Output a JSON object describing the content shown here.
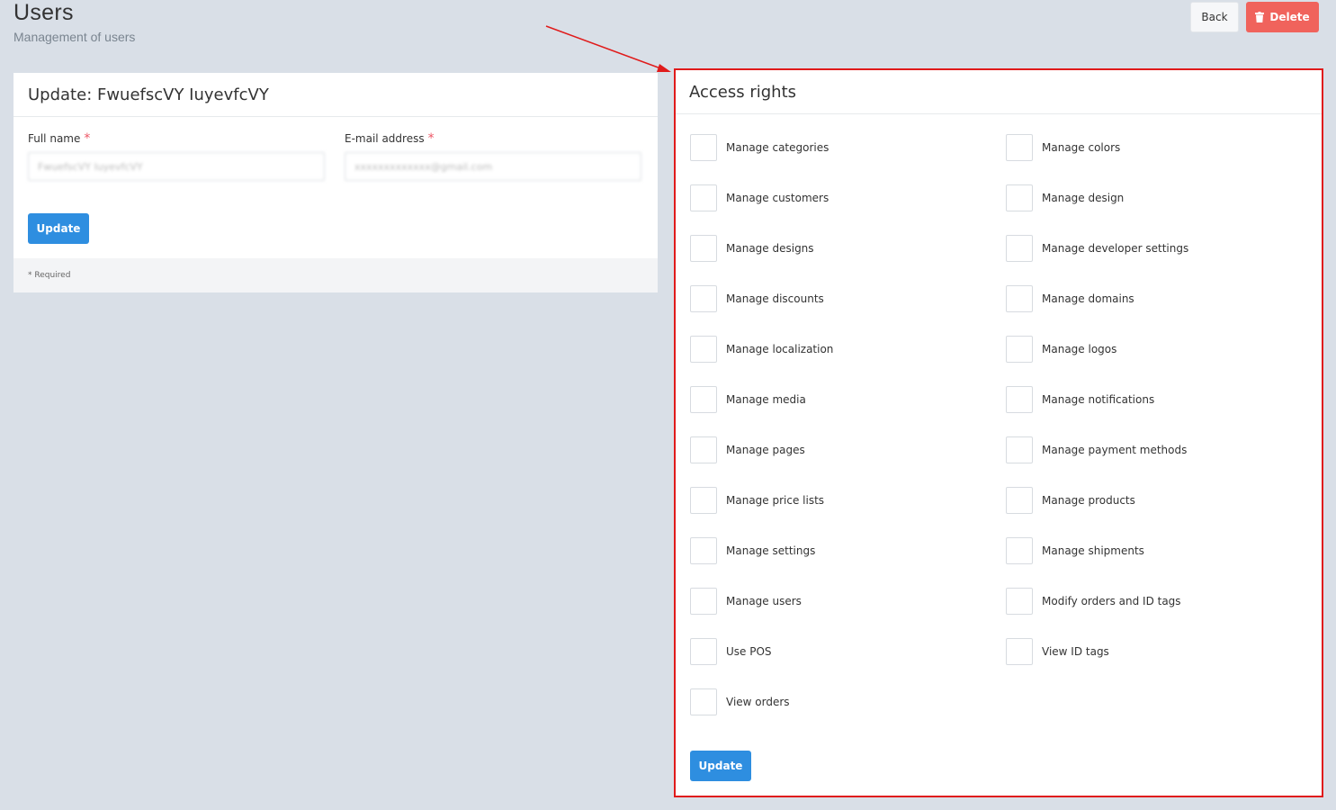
{
  "page": {
    "title": "Users",
    "subtitle": "Management of users"
  },
  "toolbar": {
    "back_label": "Back",
    "delete_label": "Delete",
    "delete_icon": "trash-icon"
  },
  "update_form": {
    "title": "Update: FwuefscVY IuyevfcVY",
    "full_name_label": "Full name",
    "email_label": "E-mail address",
    "required_mark": "*",
    "full_name_value": "FwuefscVY IuyevfcVY",
    "email_value": "xxxxxxxxxxxxx@gmail.com",
    "update_label": "Update",
    "footer_note": "* Required"
  },
  "access_rights": {
    "title": "Access rights",
    "update_label": "Update",
    "items": [
      {
        "label": "Manage categories",
        "checked": false
      },
      {
        "label": "Manage colors",
        "checked": false
      },
      {
        "label": "Manage customers",
        "checked": false
      },
      {
        "label": "Manage design",
        "checked": false
      },
      {
        "label": "Manage designs",
        "checked": false
      },
      {
        "label": "Manage developer settings",
        "checked": false
      },
      {
        "label": "Manage discounts",
        "checked": false
      },
      {
        "label": "Manage domains",
        "checked": false
      },
      {
        "label": "Manage localization",
        "checked": false
      },
      {
        "label": "Manage logos",
        "checked": false
      },
      {
        "label": "Manage media",
        "checked": false
      },
      {
        "label": "Manage notifications",
        "checked": false
      },
      {
        "label": "Manage pages",
        "checked": false
      },
      {
        "label": "Manage payment methods",
        "checked": false
      },
      {
        "label": "Manage price lists",
        "checked": false
      },
      {
        "label": "Manage products",
        "checked": false
      },
      {
        "label": "Manage settings",
        "checked": false
      },
      {
        "label": "Manage shipments",
        "checked": false
      },
      {
        "label": "Manage users",
        "checked": false
      },
      {
        "label": "Modify orders and ID tags",
        "checked": false
      },
      {
        "label": "Use POS",
        "checked": false
      },
      {
        "label": "View ID tags",
        "checked": false
      },
      {
        "label": "View orders",
        "checked": false
      }
    ]
  },
  "colors": {
    "background": "#d9dfe7",
    "primary": "#2e8ee0",
    "danger": "#f0635c",
    "highlight": "#e01b1b"
  }
}
